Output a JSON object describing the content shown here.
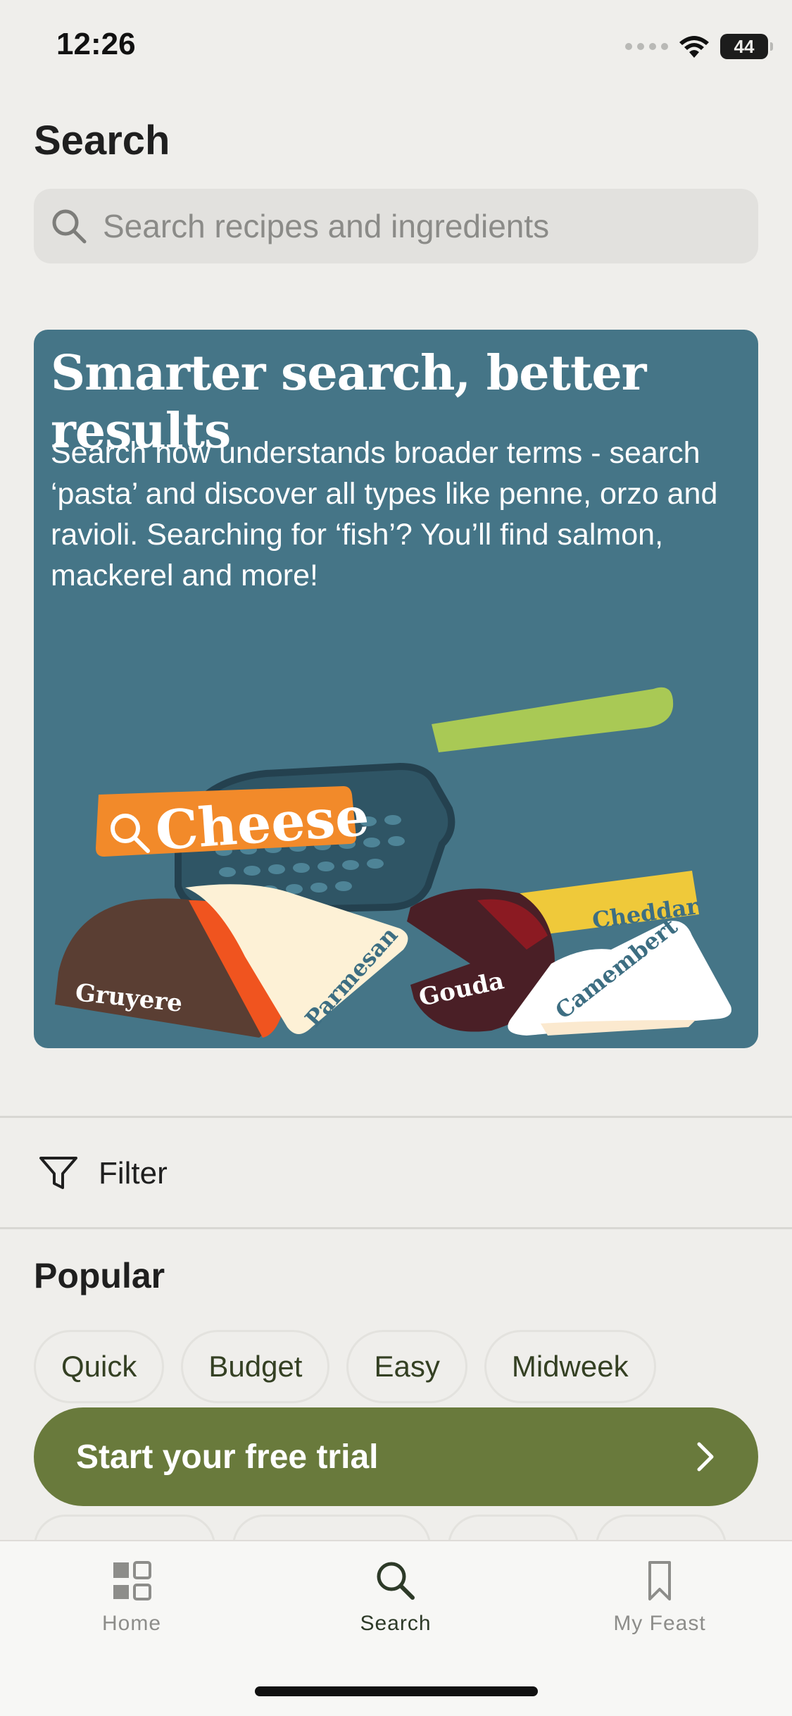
{
  "status_bar": {
    "time": "12:26",
    "battery": "44"
  },
  "header": {
    "title": "Search"
  },
  "search": {
    "placeholder": "Search recipes and ingredients"
  },
  "promo": {
    "title": "Smarter search, better results",
    "body": "Search now understands broader terms - search ‘pasta’ and discover all types like penne, orzo and ravioli. Searching for ‘fish’? You’ll find salmon, mackerel and more!",
    "illustration_labels": {
      "tag": "Cheese",
      "cheddar": "Cheddar",
      "gruyere": "Gruyere",
      "parmesan": "Parmesan",
      "gouda": "Gouda",
      "camembert": "Camembert"
    }
  },
  "filter": {
    "label": "Filter"
  },
  "popular": {
    "title": "Popular",
    "chips": [
      "Quick",
      "Budget",
      "Easy",
      "Midweek"
    ]
  },
  "cta": {
    "label": "Start your free trial"
  },
  "tabbar": {
    "tabs": [
      {
        "label": "Home",
        "icon": "home-grid-icon"
      },
      {
        "label": "Search",
        "icon": "search-icon"
      },
      {
        "label": "My Feast",
        "icon": "bookmark-icon"
      }
    ],
    "active": "Search"
  },
  "colors": {
    "background": "#efeeeb",
    "promo_bg": "#457587",
    "cta_bg": "#697a3c",
    "chip_text": "#344023"
  }
}
